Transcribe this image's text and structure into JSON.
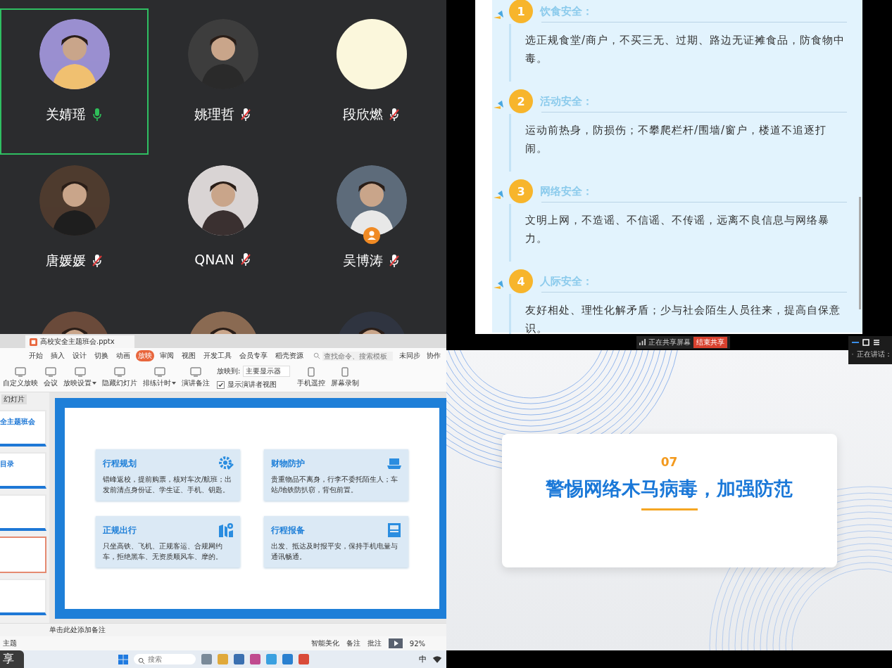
{
  "participants": [
    {
      "name": "关婧瑶",
      "muted": false,
      "speaking": true,
      "host": false
    },
    {
      "name": "姚理哲",
      "muted": true,
      "speaking": false,
      "host": false
    },
    {
      "kind": "plain",
      "name": "段欣燃",
      "muted": true,
      "speaking": false,
      "host": false
    },
    {
      "name": "唐媛媛",
      "muted": true,
      "speaking": false,
      "host": false
    },
    {
      "name": "QNAN",
      "muted": true,
      "speaking": false,
      "host": false
    },
    {
      "name": "吴博涛",
      "muted": true,
      "speaking": false,
      "host": true
    },
    {
      "kind": "cut"
    },
    {
      "kind": "cut"
    },
    {
      "kind": "cut"
    }
  ],
  "shared_document": {
    "sections": [
      {
        "number": "1",
        "heading": "饮食安全：",
        "body": "选正规食堂/商户，不买三无、过期、路边无证摊食品，防食物中毒。"
      },
      {
        "number": "2",
        "heading": "活动安全：",
        "body": "运动前热身，防损伤；不攀爬栏杆/围墙/窗户，楼道不追逐打闹。"
      },
      {
        "number": "3",
        "heading": "网络安全：",
        "body": "文明上网，不造谣、不信谣、不传谣，远离不良信息与网络暴力。"
      },
      {
        "number": "4",
        "heading": "人际安全：",
        "body": "友好相处、理性化解矛盾；少与社会陌生人员往来，提高自保意识。"
      }
    ]
  },
  "share_bar": {
    "status": "正在共享屏幕",
    "stop_button": "结束共享"
  },
  "speaker_panel": {
    "label": "正在讲话："
  },
  "wps": {
    "file_tab": "高校安全主题班会.pptx",
    "menu": [
      {
        "label": "开始",
        "selected": false
      },
      {
        "label": "插入",
        "selected": false
      },
      {
        "label": "设计",
        "selected": false
      },
      {
        "label": "切换",
        "selected": false
      },
      {
        "label": "动画",
        "selected": false
      },
      {
        "label": "放映",
        "selected": true
      },
      {
        "label": "审阅",
        "selected": false
      },
      {
        "label": "视图",
        "selected": false
      },
      {
        "label": "开发工具",
        "selected": false
      },
      {
        "label": "会员专享",
        "selected": false
      },
      {
        "label": "稻壳资源",
        "selected": false
      }
    ],
    "search": {
      "placeholder": "查找命令、搜索模板"
    },
    "sync": "未同步",
    "collab": "协作",
    "ribbon_left": [
      {
        "label": "自定义放映",
        "dropdown": false
      },
      {
        "label": "会议",
        "dropdown": false
      },
      {
        "label": "放映设置",
        "dropdown": true
      },
      {
        "label": "隐藏幻灯片",
        "dropdown": false
      },
      {
        "label": "排练计时",
        "dropdown": true
      },
      {
        "label": "演讲备注",
        "dropdown": false
      }
    ],
    "display_to": {
      "label": "放映到:",
      "value": "主要显示器"
    },
    "presenter_view": {
      "label": "显示演讲者视图",
      "checked": true
    },
    "ribbon_right": [
      {
        "label": "手机遥控",
        "dropdown": false
      },
      {
        "label": "屏幕录制",
        "dropdown": false
      }
    ],
    "panel_tab": "幻灯片",
    "thumbnails": [
      {
        "title": "全主题班会",
        "selected": false
      },
      {
        "title": "目录",
        "selected": false
      },
      {
        "selected": false
      },
      {
        "selected": true
      },
      {
        "selected": false
      }
    ],
    "slide": {
      "cards": [
        {
          "title": "行程规划",
          "body": "错峰返校，提前购票，核对车次/航班；出发前清点身份证、学生证、手机、钥匙。"
        },
        {
          "title": "财物防护",
          "body": "贵重物品不离身，行李不委托陌生人；车站/地铁防扒窃，背包前置。"
        },
        {
          "title": "正规出行",
          "body": "只坐高铁、飞机、正规客运、合规网约车，拒绝黑车、无资质顺风车、摩的。"
        },
        {
          "title": "行程报备",
          "body": "出发、抵达及时报平安，保持手机电量与通讯畅通。"
        }
      ]
    },
    "notes": {
      "placeholder": "单击此处添加备注"
    },
    "theme": "主题",
    "status": {
      "beautify": "智能美化",
      "notes": "备注",
      "comments": "批注",
      "zoom": "92%"
    }
  },
  "taskbar": {
    "search": {
      "placeholder": "搜索"
    },
    "ime": "中"
  },
  "overlay_button": "享",
  "slide_right": {
    "number": "07",
    "title": "警惕网络木马病毒，加强防范"
  }
}
